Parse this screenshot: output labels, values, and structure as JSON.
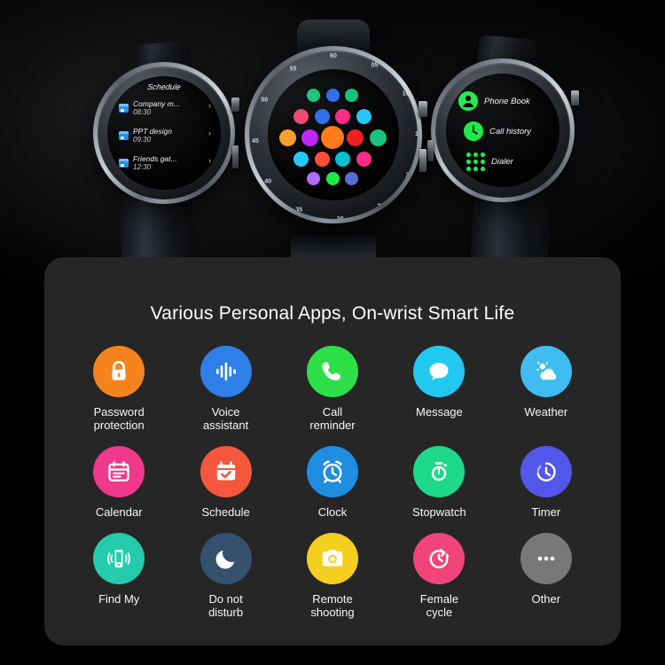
{
  "hero": {
    "left_watch": {
      "screen_title": "Schedule",
      "entries": [
        {
          "name": "Company m...",
          "time": "08:30"
        },
        {
          "name": "PPT design",
          "time": "09:30"
        },
        {
          "name": "Friends gat...",
          "time": "12:30"
        }
      ]
    },
    "center_watch": {
      "bezel_marks": [
        "05",
        "10",
        "15",
        "20",
        "25",
        "30",
        "35",
        "40",
        "45",
        "50",
        "55",
        "60"
      ],
      "app_grid_icon_colors": [
        "#19c37d",
        "#2f6fed",
        "#19c37d",
        "#ef476f",
        "#2f6fed",
        "#ff2d87",
        "#26c6f5",
        "#f59e2b",
        "#c026ff",
        "#ff7a18",
        "#ef2020",
        "#19c37d",
        "#26c6f5",
        "#ff4d35",
        "#00c2d1",
        "#ff2d87",
        "#b06bff",
        "#1ee846",
        "#5b6bd6"
      ]
    },
    "right_watch": {
      "menu": [
        {
          "label": "Phone Book",
          "icon": "contact-icon"
        },
        {
          "label": "Call history",
          "icon": "clock-icon"
        },
        {
          "label": "Dialer",
          "icon": "keypad-icon"
        }
      ],
      "accent_color": "#1ee846"
    }
  },
  "panel": {
    "title": "Various Personal Apps, On-wrist Smart Life",
    "background_color": "#262626",
    "apps": [
      {
        "label": "Password\nprotection",
        "icon": "lock-icon",
        "color": "#f5841f"
      },
      {
        "label": "Voice\nassistant",
        "icon": "waveform-icon",
        "color": "#2f7fe8"
      },
      {
        "label": "Call\nreminder",
        "icon": "phone-icon",
        "color": "#2ee048"
      },
      {
        "label": "Message",
        "icon": "chat-bubble-icon",
        "color": "#21c8f0"
      },
      {
        "label": "Weather",
        "icon": "cloud-sun-icon",
        "color": "#3fbdf0"
      },
      {
        "label": "Calendar",
        "icon": "calendar-icon",
        "color": "#f0398a"
      },
      {
        "label": "Schedule",
        "icon": "checklist-icon",
        "color": "#f4573c"
      },
      {
        "label": "Clock",
        "icon": "alarm-clock-icon",
        "color": "#1f8de0"
      },
      {
        "label": "Stopwatch",
        "icon": "stopwatch-icon",
        "color": "#1fd98a"
      },
      {
        "label": "Timer",
        "icon": "timer-icon",
        "color": "#5157e8"
      },
      {
        "label": "Find My",
        "icon": "find-phone-icon",
        "color": "#24cbad"
      },
      {
        "label": "Do not\ndisturb",
        "icon": "moon-icon",
        "color": "#35516e"
      },
      {
        "label": "Remote\nshooting",
        "icon": "camera-icon",
        "color": "#f5cf1f"
      },
      {
        "label": "Female\ncycle",
        "icon": "cycle-icon",
        "color": "#f0447a"
      },
      {
        "label": "Other",
        "icon": "ellipsis-icon",
        "color": "#787878"
      }
    ]
  }
}
